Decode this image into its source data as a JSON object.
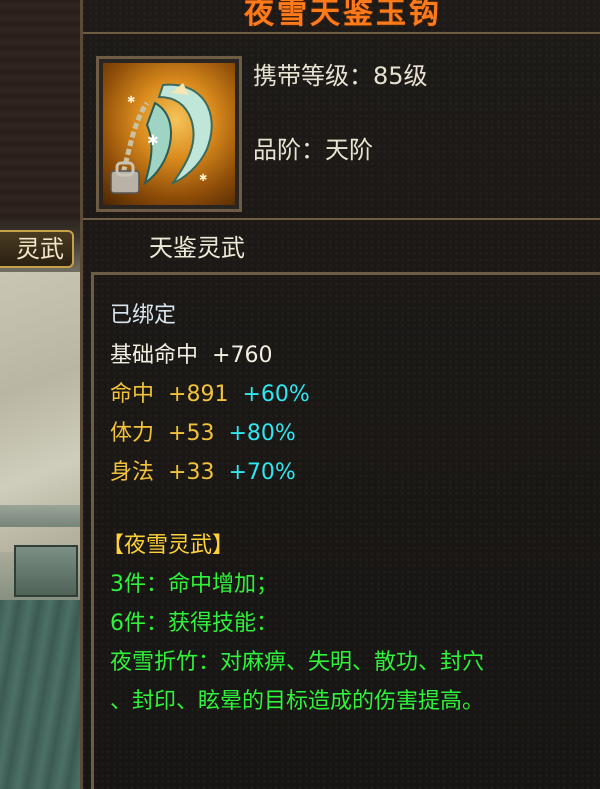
{
  "scene": {
    "tag_label": "灵武"
  },
  "tooltip": {
    "title": "夜雪天鉴玉钩",
    "carry_level_label": "携带等级：",
    "carry_level_value": "85级",
    "grade_label": "品阶：",
    "grade_value": "天阶",
    "item_type": "天鉴灵武",
    "bound_status": "已绑定",
    "base_stat": {
      "name": "基础命中",
      "value": "+760"
    },
    "attributes": [
      {
        "name": "命中",
        "value": "+891",
        "bonus": "+60%"
      },
      {
        "name": "体力",
        "value": "+53",
        "bonus": "+80%"
      },
      {
        "name": "身法",
        "value": "+33",
        "bonus": "+70%"
      }
    ],
    "set": {
      "name": "【夜雪灵武】",
      "bonus_3": "3件：命中增加；",
      "bonus_6": "6件：获得技能：",
      "skill_line_1": "夜雪折竹：对麻痹、失明、散功、封穴",
      "skill_line_2": "、封印、眩晕的目标造成的伤害提高。"
    }
  },
  "colors": {
    "title": "#ff7a1a",
    "attribute": "#f2c23c",
    "bonus": "#30e6f0",
    "set_name": "#ffd23a",
    "set_effect": "#2ff23a",
    "frame": "#6e5c45"
  }
}
